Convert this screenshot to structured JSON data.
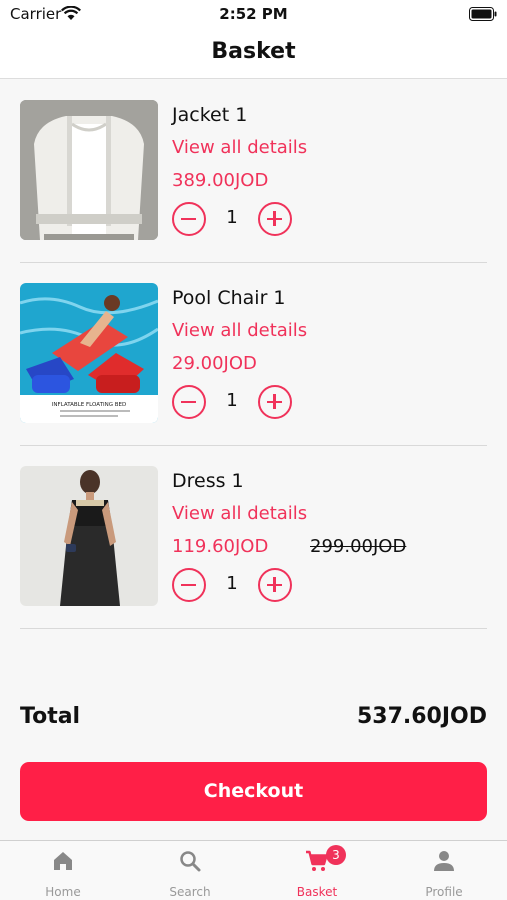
{
  "status_bar": {
    "carrier": "Carrier",
    "time": "2:52 PM"
  },
  "header": {
    "title": "Basket"
  },
  "items": [
    {
      "name": "Jacket 1",
      "details_link": "View all details",
      "price": "389.00JOD",
      "quantity": "1"
    },
    {
      "name": "Pool Chair 1",
      "details_link": "View all details",
      "price": "29.00JOD",
      "quantity": "1",
      "image_caption": "INFLATABLE FLOATING BED"
    },
    {
      "name": "Dress 1",
      "details_link": "View all details",
      "price": "119.60JOD",
      "old_price": "299.00JOD",
      "quantity": "1"
    }
  ],
  "summary": {
    "total_label": "Total",
    "total_value": "537.60JOD"
  },
  "checkout": {
    "label": "Checkout"
  },
  "tabs": [
    {
      "label": "Home",
      "icon": "home-icon",
      "active": false
    },
    {
      "label": "Search",
      "icon": "search-icon",
      "active": false
    },
    {
      "label": "Basket",
      "icon": "cart-icon",
      "active": true,
      "badge": "3"
    },
    {
      "label": "Profile",
      "icon": "user-icon",
      "active": false
    }
  ],
  "colors": {
    "accent": "#f0325a",
    "checkout_bg": "#ff1f47",
    "inactive": "#999999"
  }
}
